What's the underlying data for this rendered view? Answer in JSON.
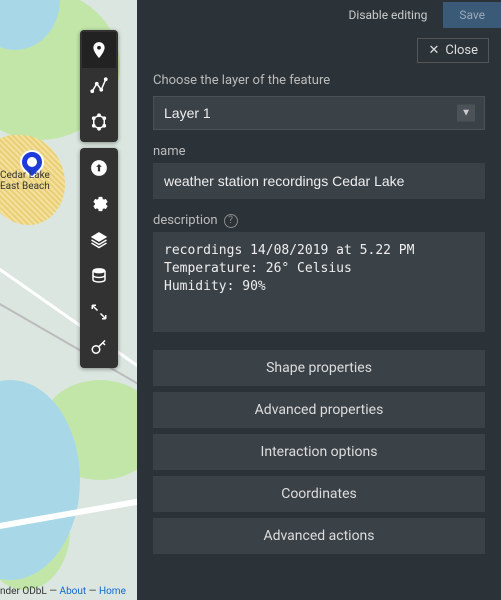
{
  "topbar": {
    "disable_editing": "Disable editing",
    "save": "Save"
  },
  "close_label": "Close",
  "panel": {
    "choose_layer_hint": "Choose the layer of the feature",
    "layer_selected": "Layer 1",
    "name_label": "name",
    "name_value": "weather station recordings Cedar Lake",
    "description_label": "description",
    "description_value": "recordings 14/08/2019 at 5.22 PM\nTemperature: 26° Celsius\nHumidity: 90%"
  },
  "sections": {
    "shape_properties": "Shape properties",
    "advanced_properties": "Advanced properties",
    "interaction_options": "Interaction options",
    "coordinates": "Coordinates",
    "advanced_actions": "Advanced actions"
  },
  "map": {
    "feature_label_line1": "Cedar Lake",
    "feature_label_line2": "East Beach",
    "attrib_prefix": "nder ODbL — ",
    "attrib_about": "About",
    "attrib_home": "Home"
  }
}
